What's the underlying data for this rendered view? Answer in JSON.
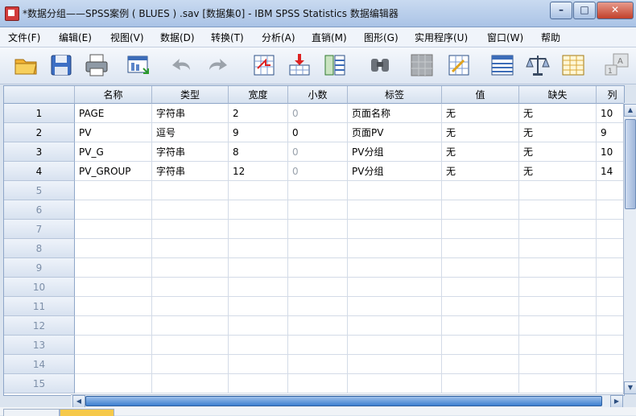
{
  "window": {
    "title": "*数据分组——SPSS案例 ( BLUES ) .sav [数据集0] - IBM SPSS Statistics 数据编辑器",
    "minimize": "–",
    "maximize": "□",
    "close": "✕"
  },
  "menu": {
    "items": [
      {
        "label": "文件(F)"
      },
      {
        "label": "编辑(E)"
      },
      {
        "label": "视图(V)"
      },
      {
        "label": "数据(D)"
      },
      {
        "label": "转换(T)"
      },
      {
        "label": "分析(A)"
      },
      {
        "label": "直销(M)"
      },
      {
        "label": "图形(G)"
      },
      {
        "label": "实用程序(U)"
      },
      {
        "label": "窗口(W)"
      },
      {
        "label": "帮助"
      }
    ]
  },
  "toolbar": {
    "icons": [
      "open-folder-icon",
      "save-icon",
      "print-icon",
      "dialog-recall-icon",
      "undo-icon",
      "redo-icon",
      "goto-case-icon",
      "goto-variable-icon",
      "variables-icon",
      "find-icon",
      "insert-cases-icon",
      "insert-variable-icon",
      "split-file-icon",
      "weight-cases-icon",
      "select-cases-icon",
      "value-labels-icon"
    ]
  },
  "grid": {
    "columns": [
      "名称",
      "类型",
      "宽度",
      "小数",
      "标签",
      "值",
      "缺失",
      "列"
    ],
    "rows": [
      {
        "num": "1",
        "cells": [
          "PAGE",
          "字符串",
          "2",
          "0",
          "页面名称",
          "无",
          "无",
          "10"
        ]
      },
      {
        "num": "2",
        "cells": [
          "PV",
          "逗号",
          "9",
          "0",
          "页面PV",
          "无",
          "无",
          "9"
        ]
      },
      {
        "num": "3",
        "cells": [
          "PV_G",
          "字符串",
          "8",
          "0",
          "PV分组",
          "无",
          "无",
          "10"
        ]
      },
      {
        "num": "4",
        "cells": [
          "PV_GROUP",
          "字符串",
          "12",
          "0",
          "PV分组",
          "无",
          "无",
          "14"
        ]
      },
      {
        "num": "5"
      },
      {
        "num": "6"
      },
      {
        "num": "7"
      },
      {
        "num": "8"
      },
      {
        "num": "9"
      },
      {
        "num": "10"
      },
      {
        "num": "11"
      },
      {
        "num": "12"
      },
      {
        "num": "13"
      },
      {
        "num": "14"
      },
      {
        "num": "15"
      }
    ]
  },
  "colors": {
    "title_bg": "#aac3e6",
    "header_bg": "#d6e1ef",
    "scroll_thumb": "#3d7fd0"
  }
}
